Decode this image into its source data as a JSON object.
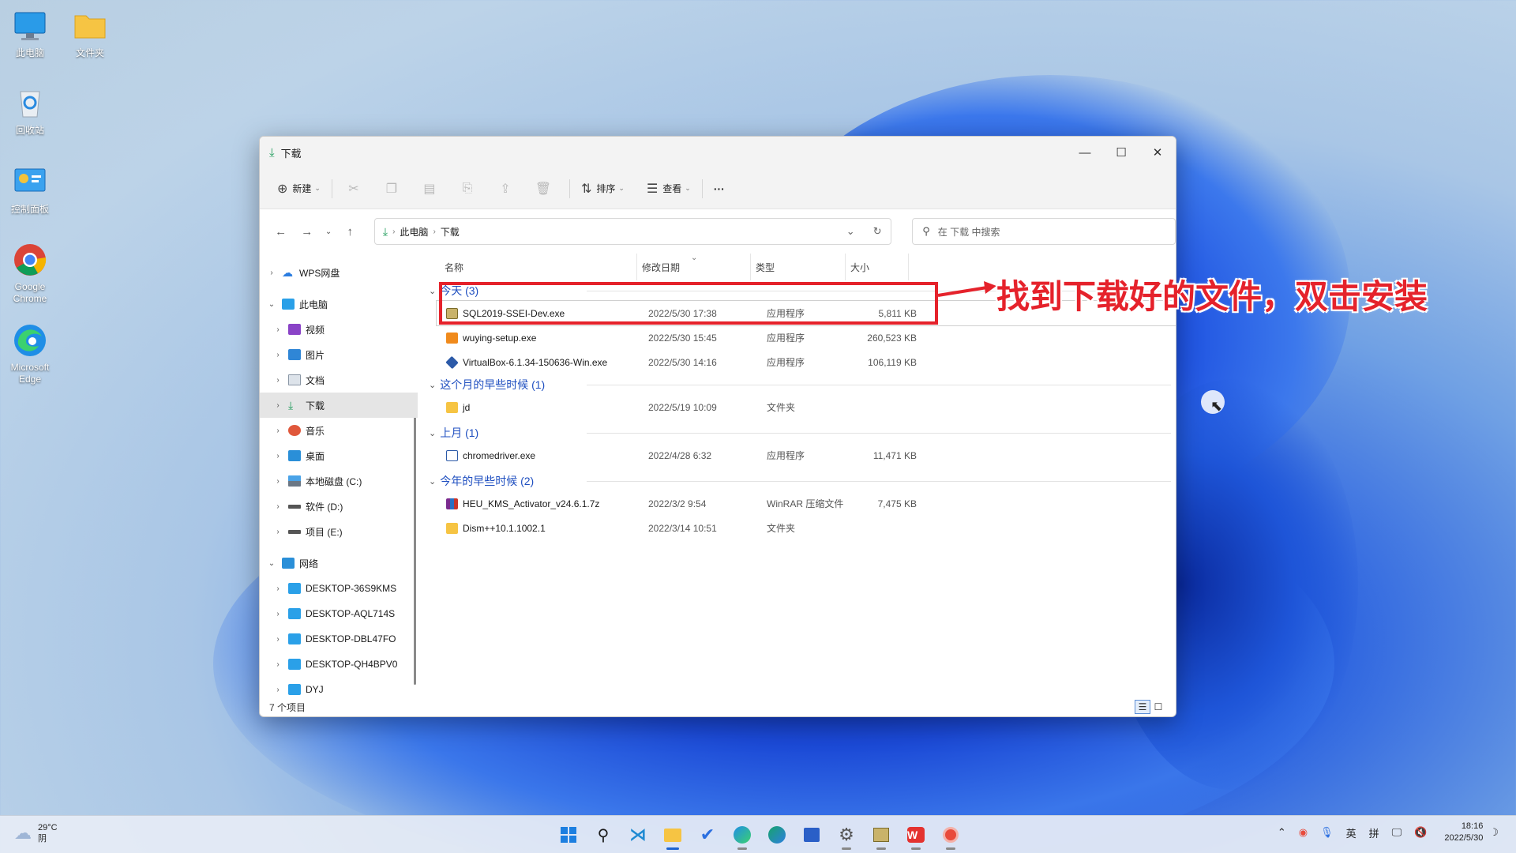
{
  "desktop": {
    "icons": [
      {
        "label": "此电脑"
      },
      {
        "label": "文件夹"
      },
      {
        "label": "回收站"
      },
      {
        "label": "控制面板"
      },
      {
        "label": "Google Chrome"
      },
      {
        "label": "Microsoft Edge"
      }
    ]
  },
  "window": {
    "title": "下载",
    "controls": {
      "minimize": "—",
      "maximize": "☐",
      "close": "✕"
    },
    "toolbar": {
      "new_label": "新建",
      "sort_label": "排序",
      "view_label": "查看",
      "more_label": "···"
    },
    "address": {
      "crumbs": [
        "此电脑",
        "下载"
      ]
    },
    "search": {
      "placeholder": "在 下载 中搜索"
    },
    "sidebar": {
      "items": [
        {
          "label": "WPS网盘"
        },
        {
          "label": "此电脑"
        },
        {
          "label": "视频"
        },
        {
          "label": "图片"
        },
        {
          "label": "文档"
        },
        {
          "label": "下载"
        },
        {
          "label": "音乐"
        },
        {
          "label": "桌面"
        },
        {
          "label": "本地磁盘 (C:)"
        },
        {
          "label": "软件 (D:)"
        },
        {
          "label": "项目 (E:)"
        },
        {
          "label": "网络"
        },
        {
          "label": "DESKTOP-36S9KMS"
        },
        {
          "label": "DESKTOP-AQL714S"
        },
        {
          "label": "DESKTOP-DBL47FO"
        },
        {
          "label": "DESKTOP-QH4BPV0"
        },
        {
          "label": "DYJ"
        }
      ]
    },
    "columns": [
      "名称",
      "修改日期",
      "类型",
      "大小"
    ],
    "groups": [
      {
        "label": "今天 (3)",
        "files": [
          {
            "name": "SQL2019-SSEI-Dev.exe",
            "date": "2022/5/30 17:38",
            "type": "应用程序",
            "size": "5,811 KB"
          },
          {
            "name": "wuying-setup.exe",
            "date": "2022/5/30 15:45",
            "type": "应用程序",
            "size": "260,523 KB"
          },
          {
            "name": "VirtualBox-6.1.34-150636-Win.exe",
            "date": "2022/5/30 14:16",
            "type": "应用程序",
            "size": "106,119 KB"
          }
        ]
      },
      {
        "label": "这个月的早些时候 (1)",
        "files": [
          {
            "name": "jd",
            "date": "2022/5/19 10:09",
            "type": "文件夹",
            "size": ""
          }
        ]
      },
      {
        "label": "上月 (1)",
        "files": [
          {
            "name": "chromedriver.exe",
            "date": "2022/4/28 6:32",
            "type": "应用程序",
            "size": "11,471 KB"
          }
        ]
      },
      {
        "label": "今年的早些时候 (2)",
        "files": [
          {
            "name": "HEU_KMS_Activator_v24.6.1.7z",
            "date": "2022/3/2 9:54",
            "type": "WinRAR 压缩文件",
            "size": "7,475 KB"
          },
          {
            "name": "Dism++10.1.1002.1",
            "date": "2022/3/14 10:51",
            "type": "文件夹",
            "size": ""
          }
        ]
      }
    ],
    "status": "7 个项目"
  },
  "annotation": {
    "text": "找到下载好的文件，双击安装",
    "color": "#e5222b"
  },
  "taskbar": {
    "weather": {
      "temp": "29°C",
      "desc": "阴"
    },
    "tray": {
      "ime1": "英",
      "ime2": "拼"
    },
    "clock": {
      "time": "18:16",
      "date": "2022/5/30"
    }
  }
}
